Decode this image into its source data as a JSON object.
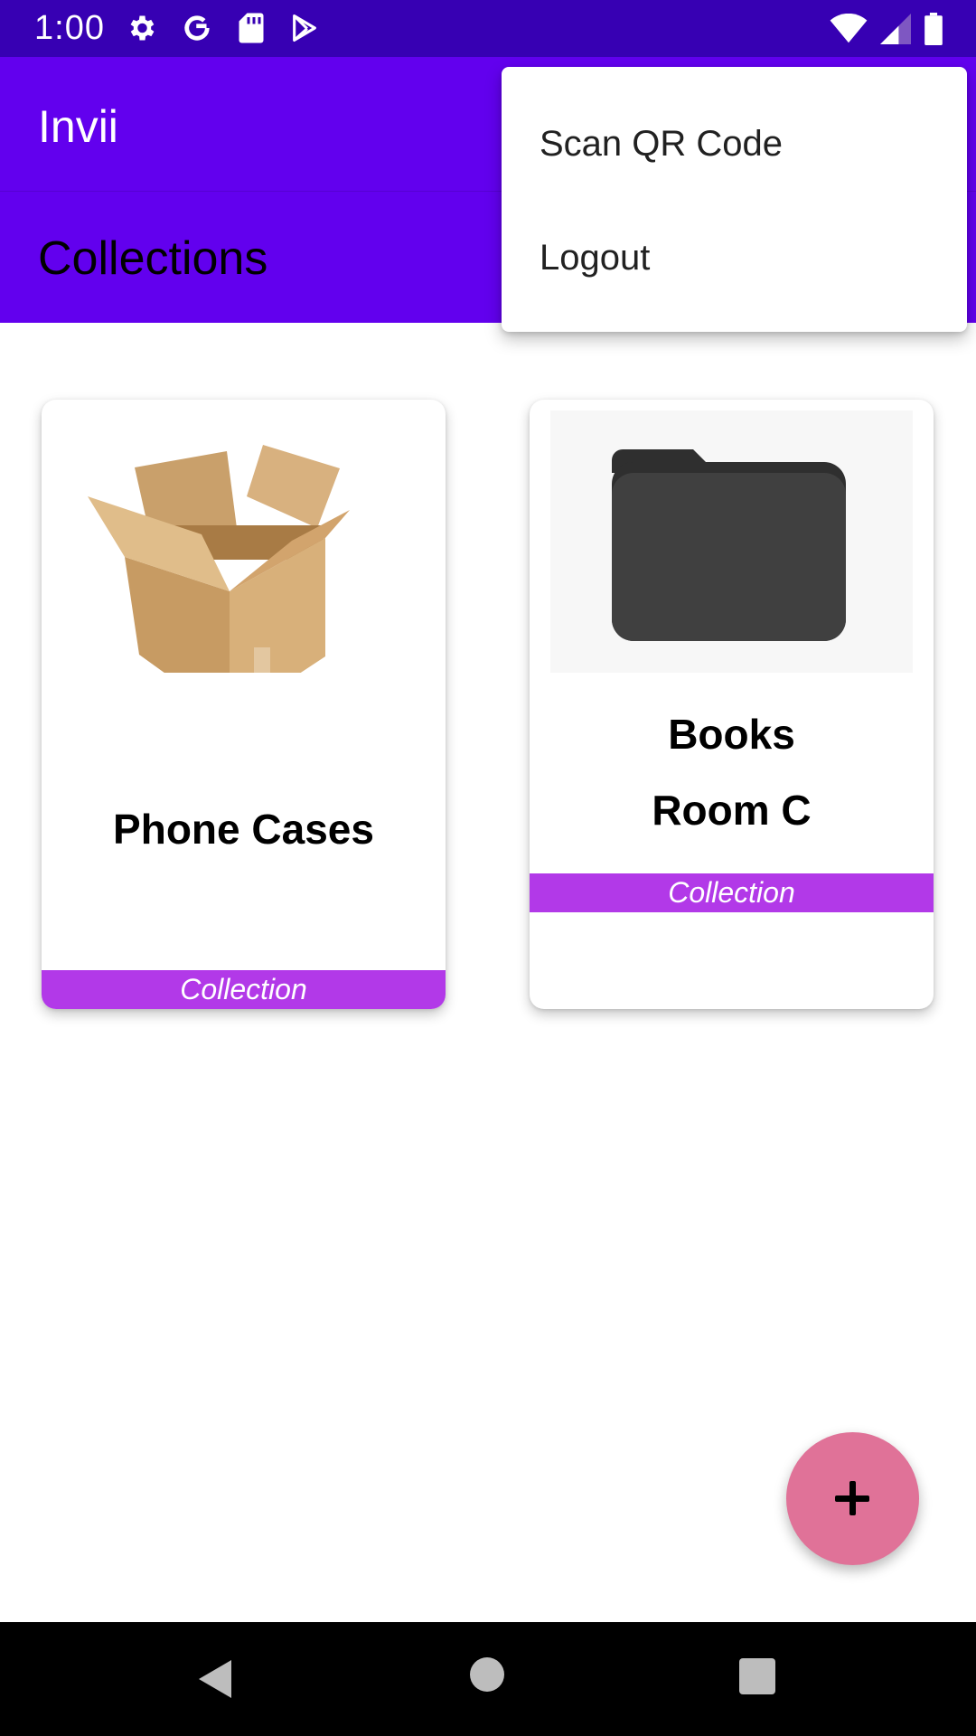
{
  "status_bar": {
    "time": "1:00",
    "left_icons": [
      "settings-icon",
      "google-icon",
      "sd-card-icon",
      "play-store-icon"
    ],
    "right_icons": [
      "wifi-icon",
      "cell-signal-icon",
      "battery-icon"
    ]
  },
  "app_bar": {
    "title": "Invii"
  },
  "section": {
    "title": "Collections"
  },
  "cards": [
    {
      "titles": [
        "Phone Cases"
      ],
      "tag": "Collection",
      "image": "cardboard-box-image"
    },
    {
      "titles": [
        "Books",
        "Room C"
      ],
      "tag": "Collection",
      "image": "folder-icon"
    }
  ],
  "menu": {
    "items": [
      "Scan QR Code",
      "Logout"
    ]
  },
  "fab": {
    "icon": "plus-icon"
  },
  "nav_bar": {
    "icons": [
      "back-icon",
      "home-icon",
      "recents-icon"
    ]
  },
  "colors": {
    "status_bar": "#3700b3",
    "app_bar": "#6200ee",
    "tag": "#b239e8",
    "fab": "#e07298"
  }
}
